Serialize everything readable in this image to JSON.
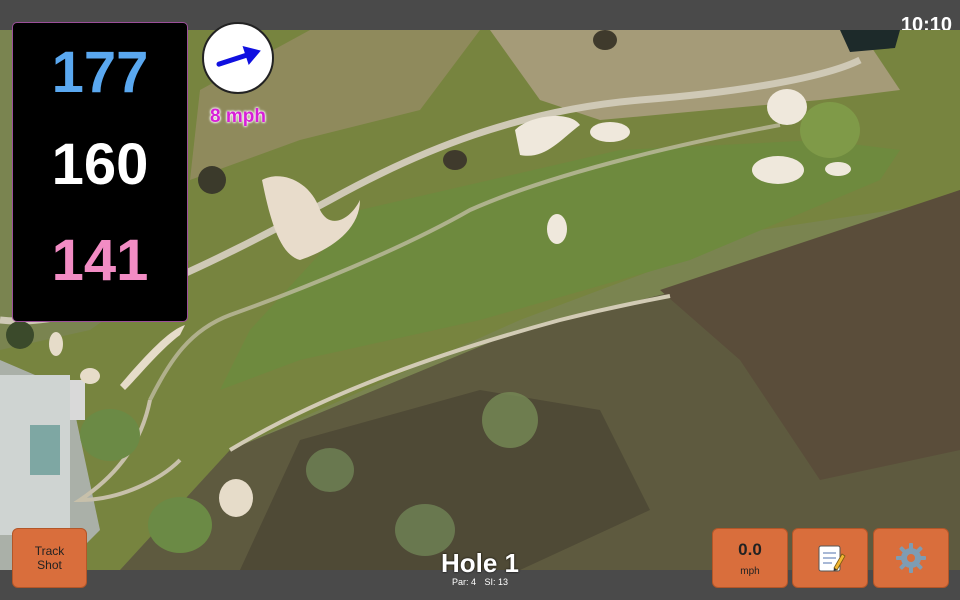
{
  "status_bar": {
    "time": "10:10"
  },
  "distances": {
    "back": "177",
    "middle": "160",
    "front": "141"
  },
  "wind": {
    "direction_icon": "arrow-right-icon",
    "speed_label": "8 mph"
  },
  "hole": {
    "title": "Hole 1",
    "par_label": "Par: 4",
    "si_label": "SI: 13"
  },
  "buttons": {
    "track_shot_line1": "Track",
    "track_shot_line2": "Shot",
    "wind_value": "0.0",
    "wind_unit": "mph",
    "notes_icon": "notepad-icon",
    "settings_icon": "gear-icon"
  },
  "colors": {
    "back_distance": "#5aa8f0",
    "middle_distance": "#ffffff",
    "front_distance": "#f28cc4",
    "button": "#d96e3c",
    "wind_text": "#d81fd8"
  }
}
